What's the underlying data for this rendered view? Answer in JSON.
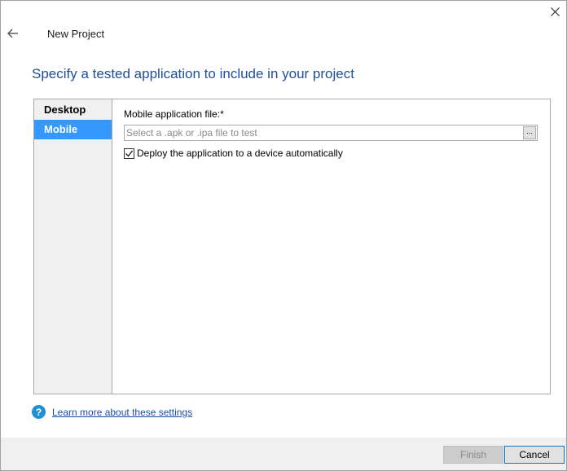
{
  "window": {
    "title": "New Project"
  },
  "icons": {
    "close": "close-icon",
    "back": "back-arrow-icon",
    "help": "help-icon",
    "check": "checkmark-icon"
  },
  "heading": "Specify a tested application to include in your project",
  "sidebar": {
    "items": [
      {
        "label": "Desktop",
        "selected": false
      },
      {
        "label": "Mobile",
        "selected": true
      }
    ]
  },
  "form": {
    "file_label": "Mobile application file:*",
    "file_value": "",
    "file_placeholder": "Select a .apk or .ipa file to test",
    "browse_label": "...",
    "deploy_label": "Deploy the application to a device automatically",
    "deploy_checked": true
  },
  "help": {
    "icon_text": "?",
    "link": "Learn more about these settings"
  },
  "buttons": {
    "finish": "Finish",
    "cancel": "Cancel",
    "finish_enabled": false
  },
  "colors": {
    "heading": "#1f4e9c",
    "selected_item": "#3399ff",
    "link": "#1a4f9a",
    "help_icon": "#1e90d6"
  }
}
